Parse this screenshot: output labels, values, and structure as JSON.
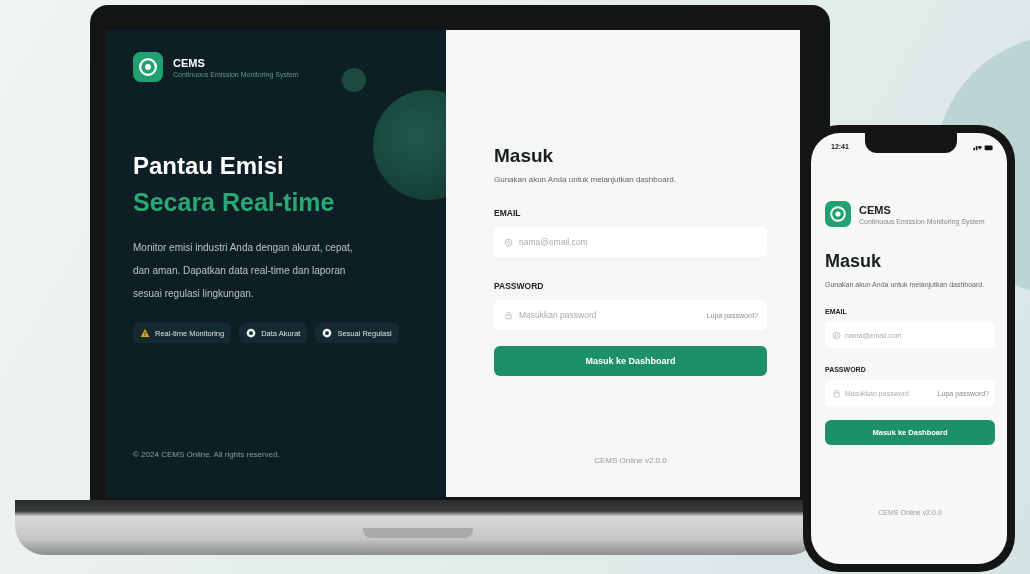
{
  "laptop": {
    "brand": {
      "name": "CEMS",
      "tagline": "Continuous Emission Monitoring System"
    },
    "headline": "Pantau Emisi",
    "headline_accent": "Secara Real-time",
    "description": "Monitor emisi industri Anda dengan akurat, cepat, dan aman. Dapatkan data real-time dan laporan sesuai regulasi lingkungan.",
    "features": [
      {
        "label": "Real-time Monitoring",
        "kind": "warning"
      },
      {
        "label": "Data Akurat",
        "kind": "check"
      },
      {
        "label": "Sesuai Regulasi",
        "kind": "check"
      }
    ],
    "copyright": "© 2024 CEMS Online. All rights reserved.",
    "login": {
      "title": "Masuk",
      "subtitle": "Gunakan akun Anda untuk melanjutkan dashboard.",
      "email_label": "EMAIL",
      "email_placeholder": "nama@email.com",
      "password_label": "PASSWORD",
      "password_placeholder": "Masukkan password",
      "forgot_link": "Lupa password?",
      "submit": "Masuk ke Dashboard",
      "version": "CEMS Online v2.0.0"
    }
  },
  "phone": {
    "time": "12:41",
    "brand": {
      "name": "CEMS",
      "tagline": "Continuous Emission Monitoring System"
    },
    "login": {
      "title": "Masuk",
      "subtitle": "Gunakan akun Anda untuk melanjutkan dashboard.",
      "email_label": "EMAIL",
      "email_placeholder": "nama@email.com",
      "password_label": "PASSWORD",
      "password_placeholder": "Masukkan password",
      "forgot_link": "Lupa password?",
      "submit": "Masuk ke Dashboard",
      "version": "CEMS Online v2.0.0"
    }
  }
}
